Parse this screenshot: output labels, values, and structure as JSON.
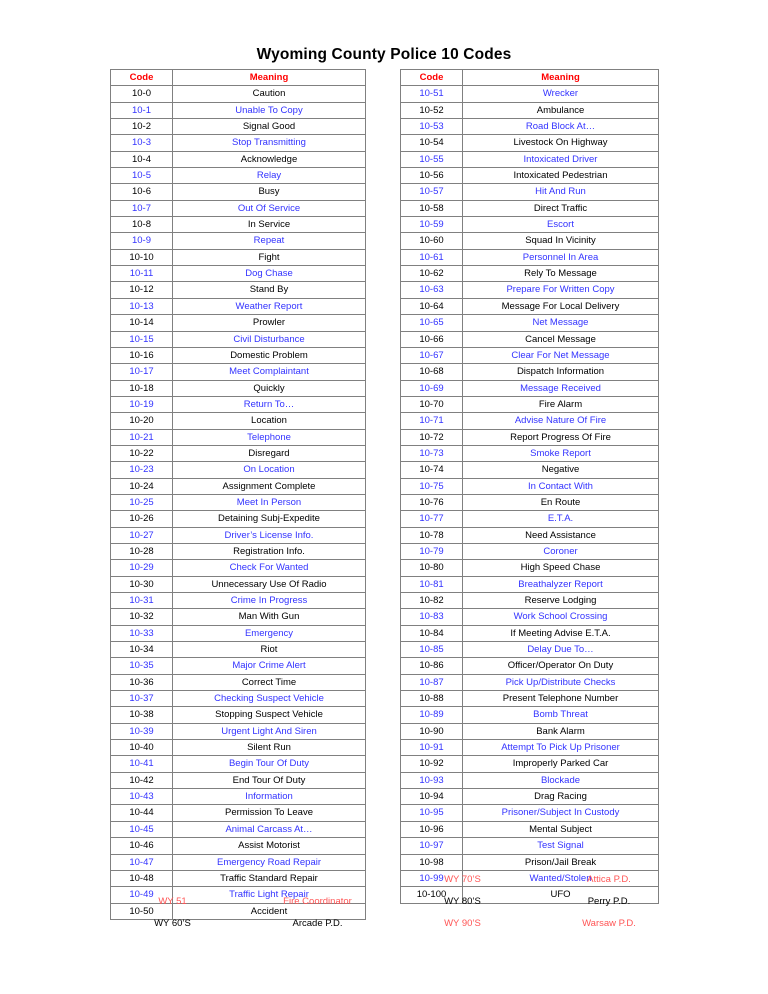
{
  "document": {
    "title": "Wyoming County Police 10 Codes"
  },
  "colors": {
    "header_red": "#ff0000",
    "code_blue": "#3333ff",
    "code_black": "#000000",
    "footnote_red": "#ff5555",
    "border_gray": "#808080"
  },
  "tables": [
    {
      "id": "left-table",
      "headers": [
        "Code",
        "Meaning"
      ],
      "rows": [
        {
          "code": "10-0",
          "meaning": "Caution",
          "color": "black"
        },
        {
          "code": "10-1",
          "meaning": "Unable To Copy",
          "color": "blue"
        },
        {
          "code": "10-2",
          "meaning": "Signal Good",
          "color": "black"
        },
        {
          "code": "10-3",
          "meaning": "Stop Transmitting",
          "color": "blue"
        },
        {
          "code": "10-4",
          "meaning": "Acknowledge",
          "color": "black"
        },
        {
          "code": "10-5",
          "meaning": "Relay",
          "color": "blue"
        },
        {
          "code": "10-6",
          "meaning": "Busy",
          "color": "black"
        },
        {
          "code": "10-7",
          "meaning": "Out Of Service",
          "color": "blue"
        },
        {
          "code": "10-8",
          "meaning": "In Service",
          "color": "black"
        },
        {
          "code": "10-9",
          "meaning": "Repeat",
          "color": "blue"
        },
        {
          "code": "10-10",
          "meaning": "Fight",
          "color": "black"
        },
        {
          "code": "10-11",
          "meaning": "Dog Chase",
          "color": "blue"
        },
        {
          "code": "10-12",
          "meaning": "Stand By",
          "color": "black"
        },
        {
          "code": "10-13",
          "meaning": "Weather Report",
          "color": "blue"
        },
        {
          "code": "10-14",
          "meaning": "Prowler",
          "color": "black"
        },
        {
          "code": "10-15",
          "meaning": "Civil Disturbance",
          "color": "blue"
        },
        {
          "code": "10-16",
          "meaning": "Domestic Problem",
          "color": "black"
        },
        {
          "code": "10-17",
          "meaning": "Meet Complaintant",
          "color": "blue"
        },
        {
          "code": "10-18",
          "meaning": "Quickly",
          "color": "black"
        },
        {
          "code": "10-19",
          "meaning": "Return To…",
          "color": "blue"
        },
        {
          "code": "10-20",
          "meaning": "Location",
          "color": "black"
        },
        {
          "code": "10-21",
          "meaning": "Telephone",
          "color": "blue"
        },
        {
          "code": "10-22",
          "meaning": "Disregard",
          "color": "black"
        },
        {
          "code": "10-23",
          "meaning": "On Location",
          "color": "blue"
        },
        {
          "code": "10-24",
          "meaning": "Assignment Complete",
          "color": "black"
        },
        {
          "code": "10-25",
          "meaning": "Meet In Person",
          "color": "blue"
        },
        {
          "code": "10-26",
          "meaning": "Detaining Subj-Expedite",
          "color": "black"
        },
        {
          "code": "10-27",
          "meaning": "Driver’s License Info.",
          "color": "blue"
        },
        {
          "code": "10-28",
          "meaning": "Registration Info.",
          "color": "black"
        },
        {
          "code": "10-29",
          "meaning": "Check For Wanted",
          "color": "blue"
        },
        {
          "code": "10-30",
          "meaning": "Unnecessary Use Of Radio",
          "color": "black"
        },
        {
          "code": "10-31",
          "meaning": "Crime In Progress",
          "color": "blue"
        },
        {
          "code": "10-32",
          "meaning": "Man With Gun",
          "color": "black"
        },
        {
          "code": "10-33",
          "meaning": "Emergency",
          "color": "blue"
        },
        {
          "code": "10-34",
          "meaning": "Riot",
          "color": "black"
        },
        {
          "code": "10-35",
          "meaning": "Major Crime Alert",
          "color": "blue"
        },
        {
          "code": "10-36",
          "meaning": "Correct Time",
          "color": "black"
        },
        {
          "code": "10-37",
          "meaning": "Checking Suspect Vehicle",
          "color": "blue"
        },
        {
          "code": "10-38",
          "meaning": "Stopping Suspect Vehicle",
          "color": "black"
        },
        {
          "code": "10-39",
          "meaning": "Urgent Light And Siren",
          "color": "blue"
        },
        {
          "code": "10-40",
          "meaning": "Silent Run",
          "color": "black"
        },
        {
          "code": "10-41",
          "meaning": "Begin Tour Of Duty",
          "color": "blue"
        },
        {
          "code": "10-42",
          "meaning": "End Tour Of Duty",
          "color": "black"
        },
        {
          "code": "10-43",
          "meaning": "Information",
          "color": "blue"
        },
        {
          "code": "10-44",
          "meaning": "Permission To Leave",
          "color": "black"
        },
        {
          "code": "10-45",
          "meaning": "Animal Carcass At…",
          "color": "blue"
        },
        {
          "code": "10-46",
          "meaning": "Assist Motorist",
          "color": "black"
        },
        {
          "code": "10-47",
          "meaning": "Emergency Road Repair",
          "color": "blue"
        },
        {
          "code": "10-48",
          "meaning": "Traffic Standard Repair",
          "color": "black"
        },
        {
          "code": "10-49",
          "meaning": "Traffic Light Repair",
          "color": "blue"
        },
        {
          "code": "10-50",
          "meaning": "Accident",
          "color": "black"
        }
      ]
    },
    {
      "id": "right-table",
      "headers": [
        "Code",
        "Meaning"
      ],
      "rows": [
        {
          "code": "10-51",
          "meaning": "Wrecker",
          "color": "blue"
        },
        {
          "code": "10-52",
          "meaning": "Ambulance",
          "color": "black"
        },
        {
          "code": "10-53",
          "meaning": "Road Block At…",
          "color": "blue"
        },
        {
          "code": "10-54",
          "meaning": "Livestock On Highway",
          "color": "black"
        },
        {
          "code": "10-55",
          "meaning": "Intoxicated Driver",
          "color": "blue"
        },
        {
          "code": "10-56",
          "meaning": "Intoxicated Pedestrian",
          "color": "black"
        },
        {
          "code": "10-57",
          "meaning": "Hit And Run",
          "color": "blue"
        },
        {
          "code": "10-58",
          "meaning": "Direct Traffic",
          "color": "black"
        },
        {
          "code": "10-59",
          "meaning": "Escort",
          "color": "blue"
        },
        {
          "code": "10-60",
          "meaning": "Squad In Vicinity",
          "color": "black"
        },
        {
          "code": "10-61",
          "meaning": "Personnel In Area",
          "color": "blue"
        },
        {
          "code": "10-62",
          "meaning": "Rely To Message",
          "color": "black"
        },
        {
          "code": "10-63",
          "meaning": "Prepare For Written Copy",
          "color": "blue"
        },
        {
          "code": "10-64",
          "meaning": "Message For Local Delivery",
          "color": "black"
        },
        {
          "code": "10-65",
          "meaning": "Net Message",
          "color": "blue"
        },
        {
          "code": "10-66",
          "meaning": "Cancel Message",
          "color": "black"
        },
        {
          "code": "10-67",
          "meaning": "Clear For Net Message",
          "color": "blue"
        },
        {
          "code": "10-68",
          "meaning": "Dispatch Information",
          "color": "black"
        },
        {
          "code": "10-69",
          "meaning": "Message Received",
          "color": "blue"
        },
        {
          "code": "10-70",
          "meaning": "Fire Alarm",
          "color": "black"
        },
        {
          "code": "10-71",
          "meaning": "Advise Nature Of Fire",
          "color": "blue"
        },
        {
          "code": "10-72",
          "meaning": "Report Progress Of Fire",
          "color": "black"
        },
        {
          "code": "10-73",
          "meaning": "Smoke Report",
          "color": "blue"
        },
        {
          "code": "10-74",
          "meaning": "Negative",
          "color": "black"
        },
        {
          "code": "10-75",
          "meaning": "In Contact With",
          "color": "blue"
        },
        {
          "code": "10-76",
          "meaning": "En Route",
          "color": "black"
        },
        {
          "code": "10-77",
          "meaning": "E.T.A.",
          "color": "blue"
        },
        {
          "code": "10-78",
          "meaning": "Need Assistance",
          "color": "black"
        },
        {
          "code": "10-79",
          "meaning": "Coroner",
          "color": "blue"
        },
        {
          "code": "10-80",
          "meaning": "High Speed Chase",
          "color": "black"
        },
        {
          "code": "10-81",
          "meaning": "Breathalyzer Report",
          "color": "blue"
        },
        {
          "code": "10-82",
          "meaning": "Reserve Lodging",
          "color": "black"
        },
        {
          "code": "10-83",
          "meaning": "Work School Crossing",
          "color": "blue"
        },
        {
          "code": "10-84",
          "meaning": "If Meeting Advise E.T.A.",
          "color": "black"
        },
        {
          "code": "10-85",
          "meaning": "Delay Due To…",
          "color": "blue"
        },
        {
          "code": "10-86",
          "meaning": "Officer/Operator On Duty",
          "color": "black"
        },
        {
          "code": "10-87",
          "meaning": "Pick Up/Distribute Checks",
          "color": "blue"
        },
        {
          "code": "10-88",
          "meaning": "Present Telephone Number",
          "color": "black"
        },
        {
          "code": "10-89",
          "meaning": "Bomb Threat",
          "color": "blue"
        },
        {
          "code": "10-90",
          "meaning": "Bank Alarm",
          "color": "black"
        },
        {
          "code": "10-91",
          "meaning": "Attempt To Pick Up Prisoner",
          "color": "blue"
        },
        {
          "code": "10-92",
          "meaning": "Improperly Parked Car",
          "color": "black"
        },
        {
          "code": "10-93",
          "meaning": "Blockade",
          "color": "blue"
        },
        {
          "code": "10-94",
          "meaning": "Drag Racing",
          "color": "black"
        },
        {
          "code": "10-95",
          "meaning": "Prisoner/Subject In Custody",
          "color": "blue"
        },
        {
          "code": "10-96",
          "meaning": "Mental Subject",
          "color": "black"
        },
        {
          "code": "10-97",
          "meaning": "Test Signal",
          "color": "blue"
        },
        {
          "code": "10-98",
          "meaning": "Prison/Jail Break",
          "color": "black"
        },
        {
          "code": "10-99",
          "meaning": "Wanted/Stolen",
          "color": "blue"
        },
        {
          "code": "10-100",
          "meaning": "UFO",
          "color": "black"
        }
      ]
    }
  ],
  "footnotes": {
    "left": [
      {
        "code": "WY 51",
        "meaning": "Fire Coordinator",
        "color": "red"
      },
      {
        "code": "WY 60’S",
        "meaning": "Arcade P.D.",
        "color": "dark"
      }
    ],
    "right": [
      {
        "code": "WY 70’S",
        "meaning": "Attica P.D.",
        "color": "red"
      },
      {
        "code": "WY 80’S",
        "meaning": "Perry P.D.",
        "color": "dark"
      },
      {
        "code": "WY 90’S",
        "meaning": "Warsaw P.D.",
        "color": "red"
      }
    ]
  }
}
